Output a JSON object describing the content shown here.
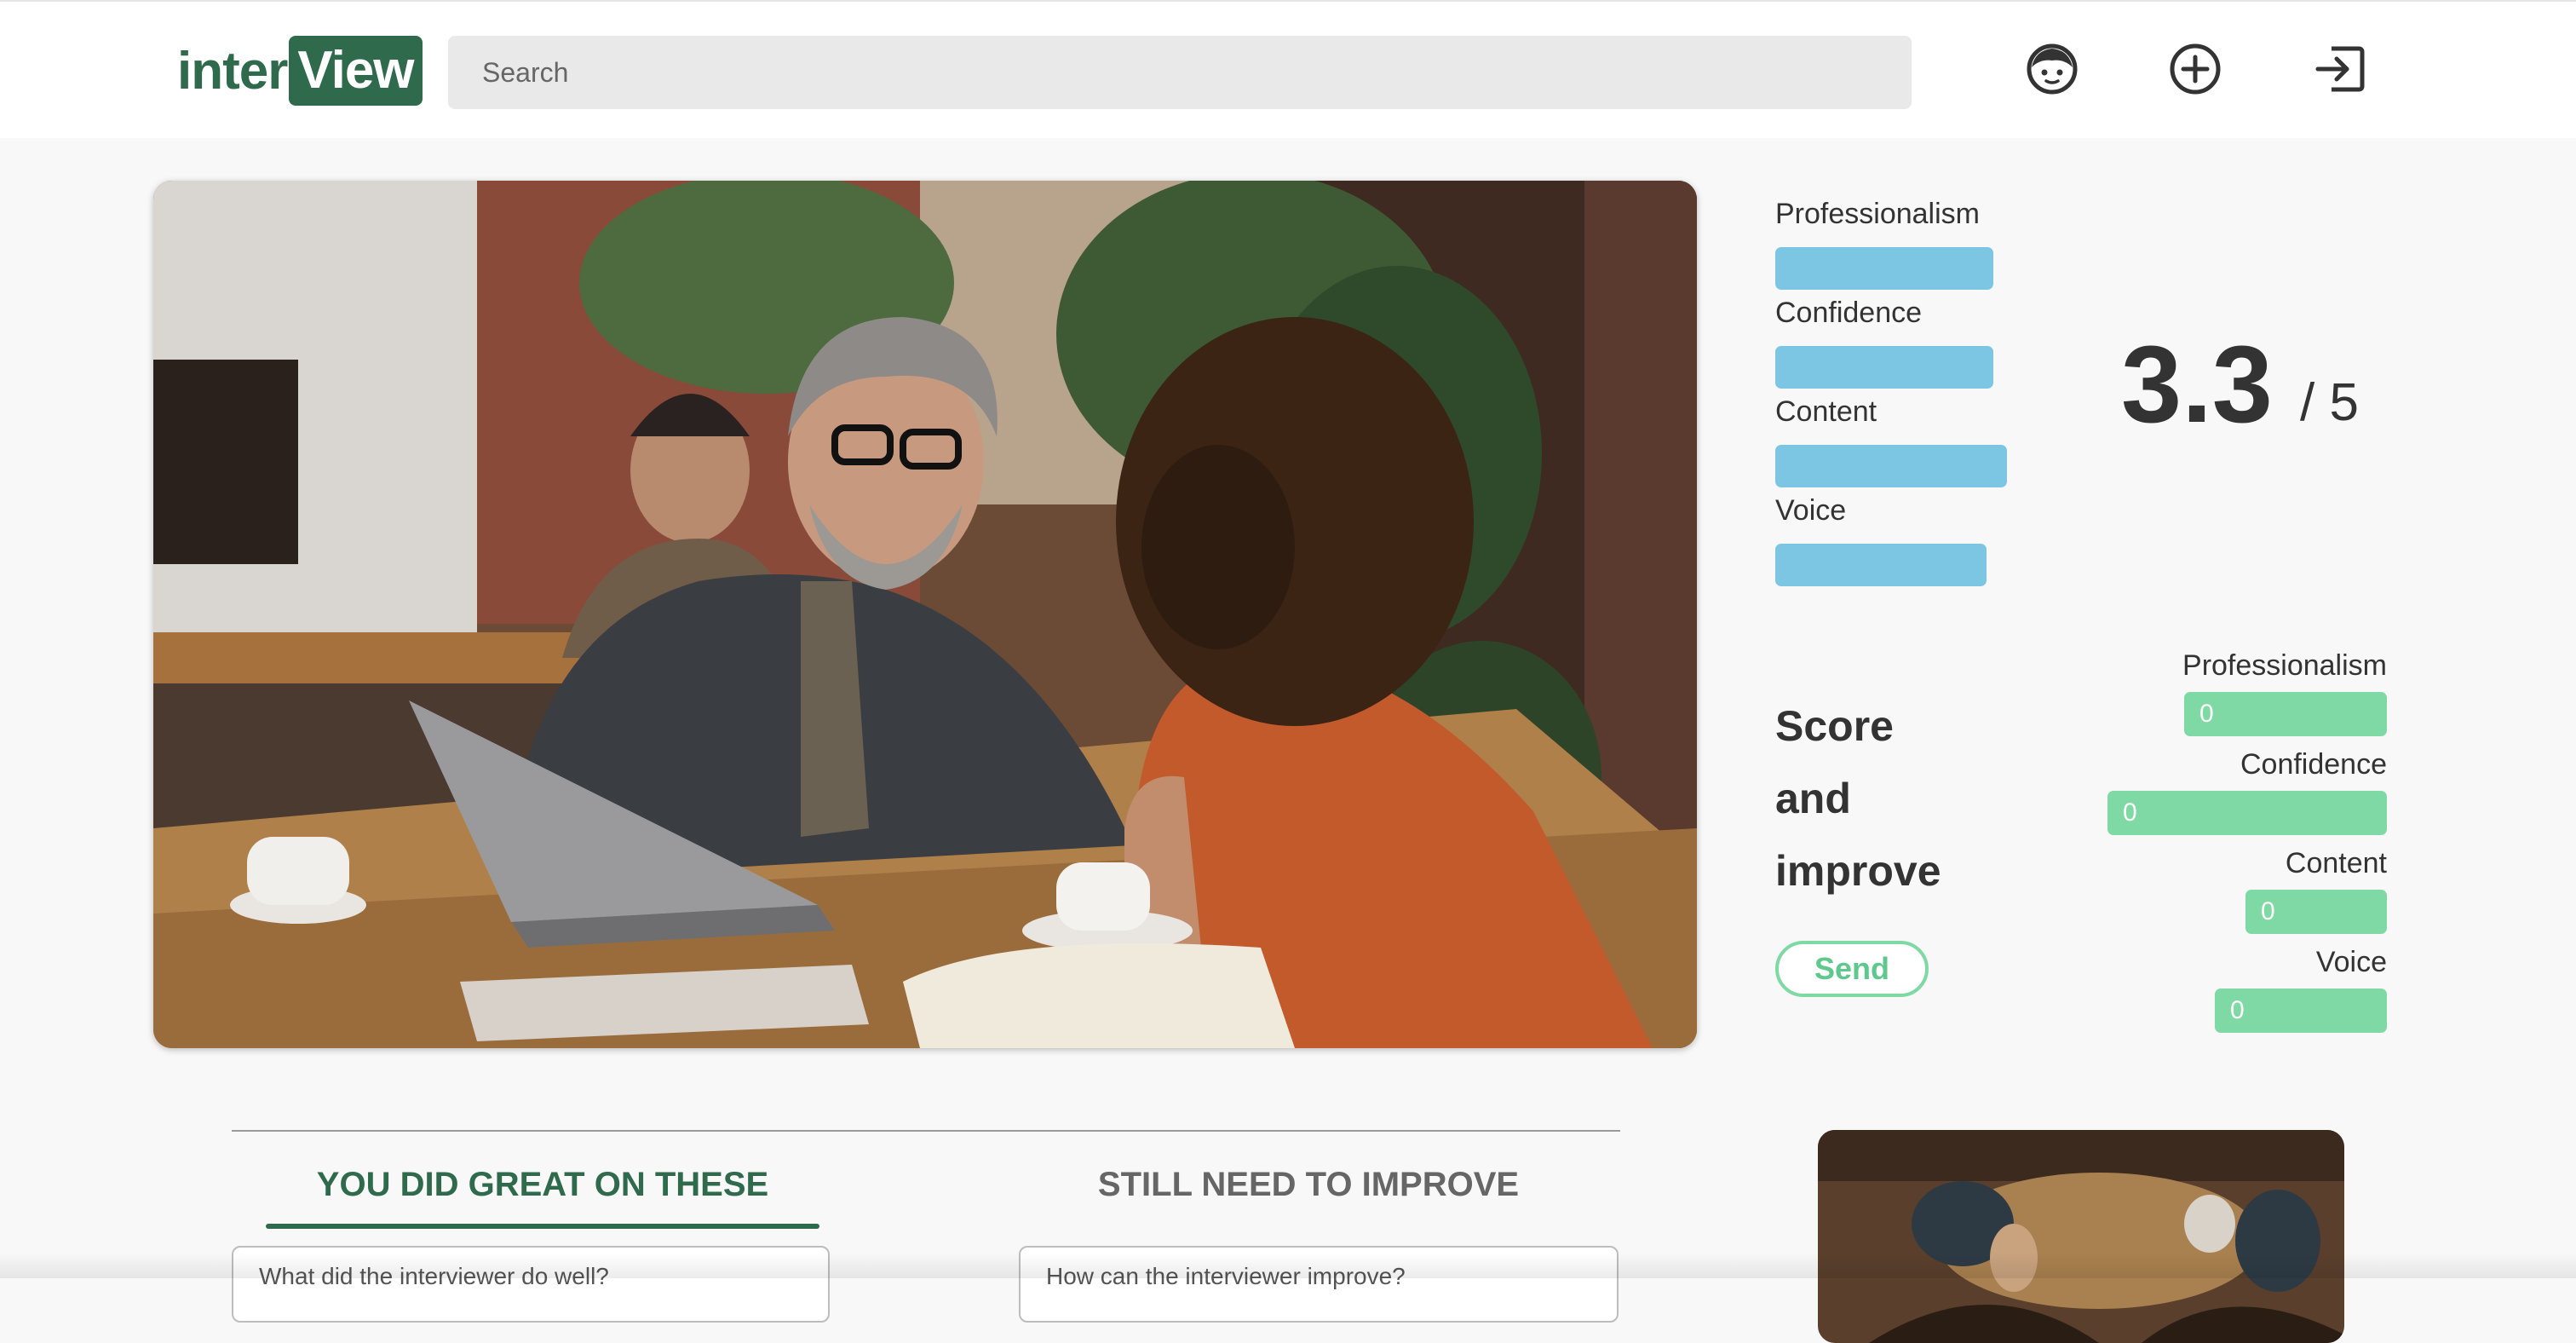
{
  "logo": {
    "part1": "inter",
    "part2": "View"
  },
  "search": {
    "placeholder": "Search"
  },
  "nav_icons": [
    "face-icon",
    "add-circle-icon",
    "logout-icon"
  ],
  "ratings": [
    {
      "label": "Professionalism",
      "fill": 0.9
    },
    {
      "label": "Confidence",
      "fill": 0.9
    },
    {
      "label": "Content",
      "fill": 0.96
    },
    {
      "label": "Voice",
      "fill": 0.87
    }
  ],
  "overall": {
    "score": "3.3",
    "denominator": "/ 5"
  },
  "score_section": {
    "title_lines": [
      "Score",
      "and",
      "improve"
    ],
    "send_label": "Send",
    "inputs": [
      {
        "label": "Professionalism",
        "value": "0"
      },
      {
        "label": "Confidence",
        "value": "0"
      },
      {
        "label": "Content",
        "value": "0"
      },
      {
        "label": "Voice",
        "value": "0"
      }
    ]
  },
  "feedback": {
    "tab_great": "YOU DID GREAT ON THESE",
    "tab_improve": "STILL NEED TO IMPROVE",
    "great_placeholder": "What did the interviewer do well?",
    "improve_placeholder": "How can the interviewer improve?"
  },
  "colors": {
    "brand": "#2f6a4c",
    "rating_bar": "#7cc6e4",
    "score_input": "#7fd9a4"
  }
}
